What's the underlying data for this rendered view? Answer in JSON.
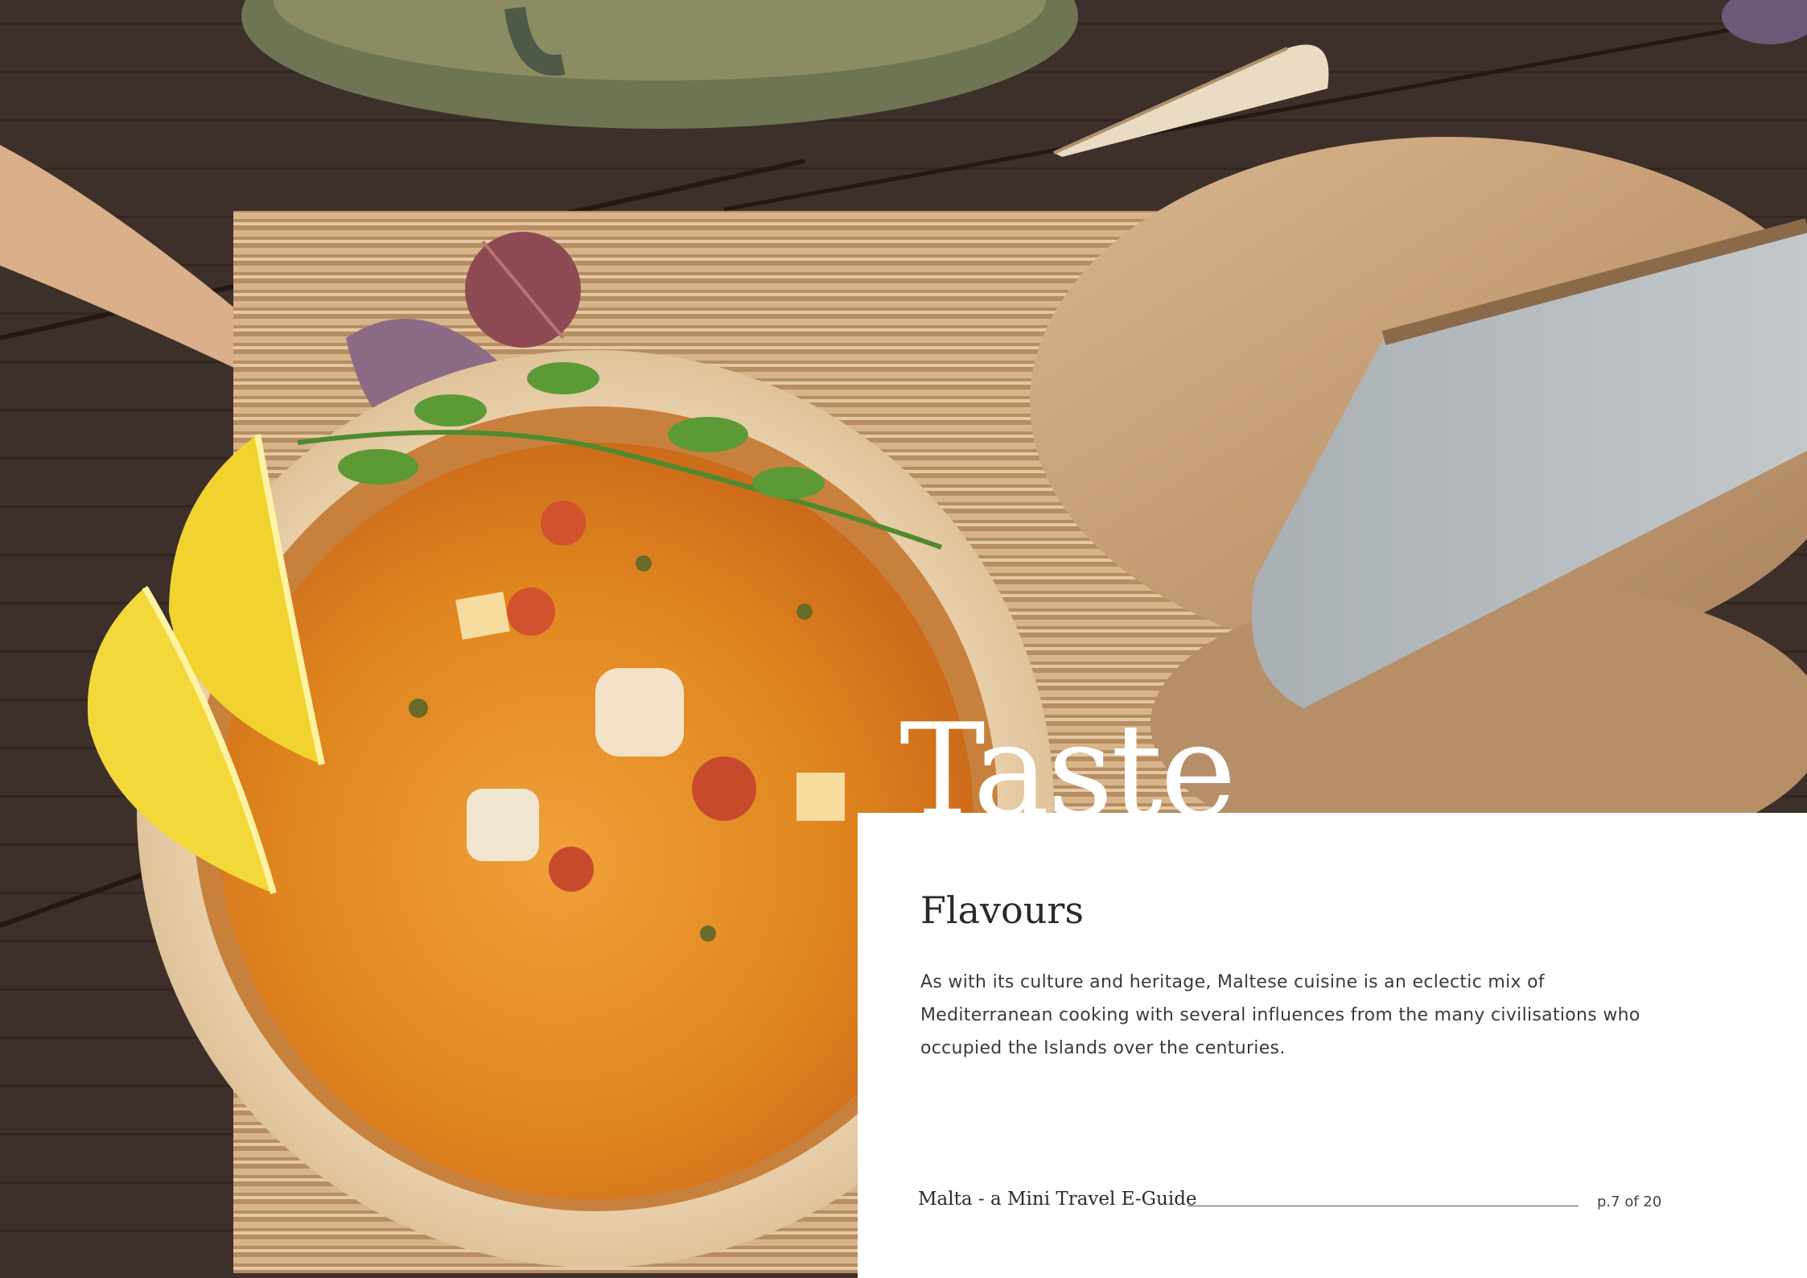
{
  "page": {
    "big_title": "Taste",
    "subtitle": "Flavours",
    "body": "As with its culture and heritage, Maltese cuisine is an eclectic mix of Mediterranean cooking with several influences from the many civilisations who occupied the Islands over the centuries.",
    "footer_title": "Malta - a Mini Travel E-Guide",
    "page_number": "p.7 of 20"
  },
  "photo": {
    "description_icon": "food-photo",
    "colors": {
      "table": "#3b2d27",
      "mat": "#c9a27a",
      "soup": "#e28a1e",
      "bowl": "#e8cfa9",
      "bread": "#c9a47e",
      "lemon": "#f3d63a"
    }
  }
}
